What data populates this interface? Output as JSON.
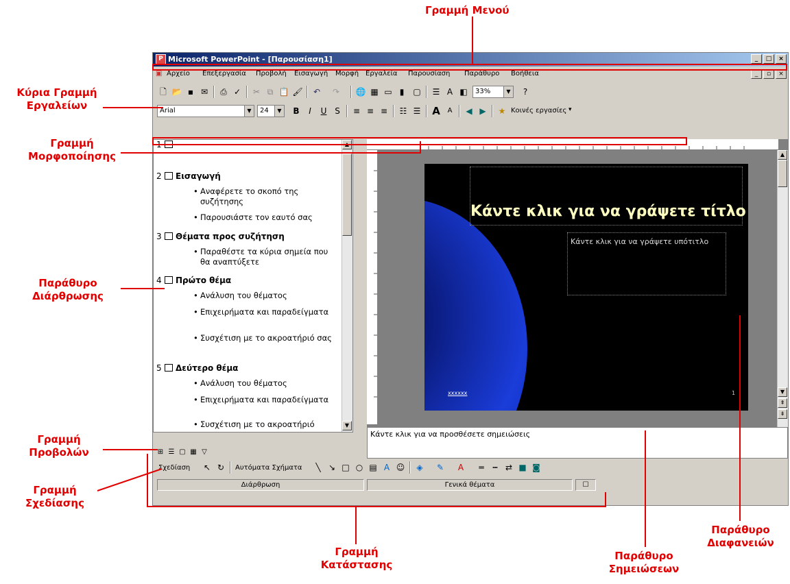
{
  "window": {
    "title": "Microsoft PowerPoint - [Παρουσίαση1]",
    "controls": [
      "_",
      "□",
      "×"
    ],
    "doc_controls": [
      "_",
      "▫",
      "×"
    ]
  },
  "menu": [
    "Αρχείο",
    "Επεξεργασία",
    "Προβολή",
    "Εισαγωγή",
    "Μορφή",
    "Εργαλεία",
    "Παρουσίαση",
    "Παράθυρο",
    "Βοήθεια"
  ],
  "standard_toolbar": {
    "zoom": "33%"
  },
  "formatting_toolbar": {
    "font": "Arial",
    "size": "24",
    "common_tasks": "Κοινές εργασίες"
  },
  "outline": {
    "slides": [
      {
        "num": "1",
        "title": "",
        "bullets": []
      },
      {
        "num": "2",
        "title": "Εισαγωγή",
        "bullets": [
          "Αναφέρετε το σκοπό της συζήτησης",
          "Παρουσιάστε τον εαυτό σας"
        ]
      },
      {
        "num": "3",
        "title": "Θέματα προς συζήτηση",
        "bullets": [
          "Παραθέστε τα κύρια σημεία που θα αναπτύξετε"
        ]
      },
      {
        "num": "4",
        "title": "Πρώτο θέμα",
        "bullets": [
          "Ανάλυση του θέματος",
          "Επιχειρήματα και παραδείγματα",
          "Συσχέτιση με το ακροατήριό σας"
        ]
      },
      {
        "num": "5",
        "title": "Δεύτερο θέμα",
        "bullets": [
          "Ανάλυση του θέματος",
          "Επιχειρήματα και παραδείγματα",
          "Συσχέτιση με το ακροατήριό"
        ]
      }
    ]
  },
  "slide": {
    "title_placeholder": "Κάντε κλικ για να γράψετε τίτλο",
    "subtitle_placeholder": "Κάντε κλικ για να γράψετε υπότιτλο",
    "footer": "xxxxxx",
    "number": "1"
  },
  "notes": {
    "placeholder": "Κάντε κλικ για να προσθέσετε σημειώσεις"
  },
  "drawing_toolbar": {
    "draw": "Σχεδίαση",
    "autoshapes": "Αυτόματα Σχήματα"
  },
  "status": {
    "view": "Διάρθρωση",
    "design": "Γενικά θέματα"
  },
  "annotations": {
    "menu_bar": "Γραμμή Μενού",
    "main_toolbar": [
      "Κύρια Γραμμή",
      "Εργαλείων"
    ],
    "formatting_bar": [
      "Γραμμή",
      "Μορφοποίησης"
    ],
    "outline_pane": [
      "Παράθυρο",
      "Διάρθρωσης"
    ],
    "views_bar": [
      "Γραμμή",
      "Προβολών"
    ],
    "drawing_bar": [
      "Γραμμή",
      "Σχεδίασης"
    ],
    "status_bar": [
      "Γραμμή",
      "Κατάστασης"
    ],
    "notes_pane": [
      "Παράθυρο",
      "Σημειώσεων"
    ],
    "slide_pane": [
      "Παράθυρο",
      "Διαφανειών"
    ]
  },
  "colors": {
    "annotation": "#e00000",
    "titlebar": "#0a246a",
    "slide_title": "#ffffc0"
  }
}
